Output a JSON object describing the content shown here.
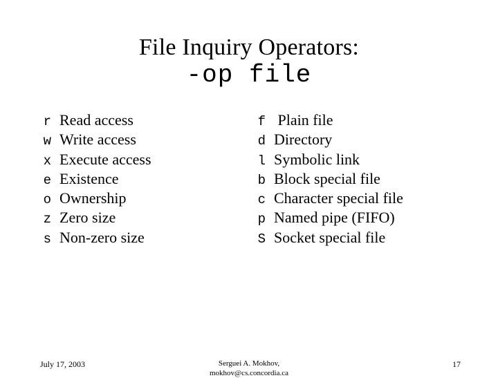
{
  "slide": {
    "title": {
      "main": "File Inquiry Operators:",
      "sub": "-op file"
    },
    "left_column": [
      {
        "key": "r",
        "desc": "Read access"
      },
      {
        "key": "w",
        "desc": "Write access"
      },
      {
        "key": "x",
        "desc": "Execute access"
      },
      {
        "key": "e",
        "desc": "Existence"
      },
      {
        "key": "o",
        "desc": "Ownership"
      },
      {
        "key": "z",
        "desc": "Zero size"
      },
      {
        "key": "s",
        "desc": "Non-zero size"
      }
    ],
    "right_column": [
      {
        "key": "f",
        "desc": " Plain file"
      },
      {
        "key": "d",
        "desc": "Directory"
      },
      {
        "key": "l",
        "desc": "Symbolic link"
      },
      {
        "key": "b",
        "desc": "Block special file"
      },
      {
        "key": "c",
        "desc": "Character special file"
      },
      {
        "key": "p",
        "desc": "Named pipe (FIFO)"
      },
      {
        "key": "S",
        "desc": "Socket special file"
      }
    ],
    "footer": {
      "date": "July 17, 2003",
      "author": "Serguei A. Mokhov,",
      "email": "mokhov@cs.concordia.ca",
      "page": "17"
    }
  },
  "colors": {
    "background": "#ffffff",
    "text": "#000000"
  }
}
